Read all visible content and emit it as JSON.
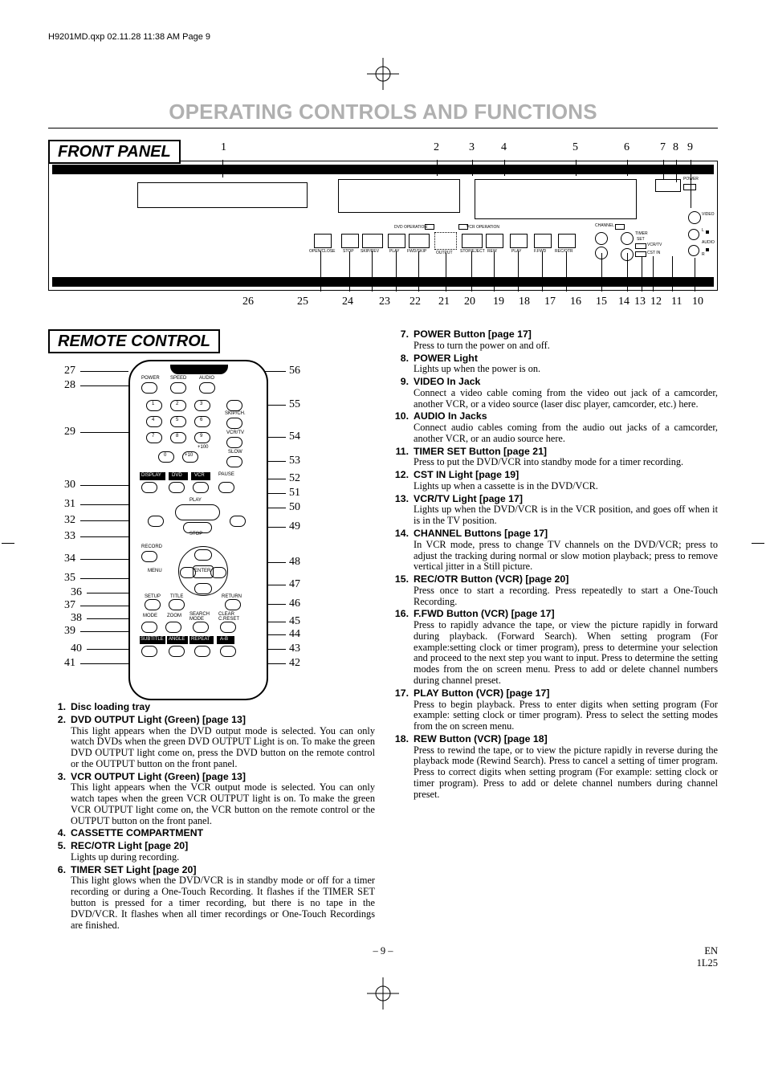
{
  "header_line": "H9201MD.qxp  02.11.28 11:38 AM  Page 9",
  "page_title": "OPERATING CONTROLS AND FUNCTIONS",
  "labels": {
    "front_panel": "FRONT PANEL",
    "remote_control": "REMOTE CONTROL"
  },
  "front_panel": {
    "callouts_top": [
      "1",
      "2",
      "3",
      "4",
      "5",
      "6",
      "7",
      "8",
      "9"
    ],
    "callouts_bottom": [
      "26",
      "25",
      "24",
      "23",
      "22",
      "21",
      "20",
      "19",
      "18",
      "17",
      "16",
      "15",
      "14",
      "13",
      "12",
      "11",
      "10"
    ],
    "panel_text": {
      "dvd_op": "DVD OPERATION",
      "vcr_op": "VCR OPERATION",
      "open_close": "OPEN/CLOSE",
      "stop": "STOP",
      "skip_rev": "SKIP/REV",
      "play": "PLAY",
      "fwd_skip": "FWD/SKIP",
      "output": "OUTPUT",
      "stop2": "STOP/EJECT",
      "rew": "REW",
      "play2": "PLAY",
      "ffwd": "F.FWD",
      "rec_otr": "REC/OTR",
      "channel": "CHANNEL",
      "timer": "TIMER",
      "set": "SET",
      "vcr_tv": "VCR/TV",
      "cst_in": "CST IN",
      "power": "POWER",
      "video": "VIDEO",
      "audio": "AUDIO",
      "l": "L",
      "r": "R"
    }
  },
  "remote": {
    "callouts_left": [
      "27",
      "28",
      "29",
      "30",
      "31",
      "32",
      "33",
      "34",
      "35",
      "36",
      "37",
      "38",
      "39",
      "40",
      "41"
    ],
    "callouts_right": [
      "56",
      "55",
      "54",
      "53",
      "52",
      "51",
      "50",
      "49",
      "48",
      "47",
      "46",
      "45",
      "44",
      "43",
      "42"
    ],
    "labels": {
      "power": "POWER",
      "speed": "SPEED",
      "audio": "AUDIO",
      "skip_ch": "SKIP/CH.",
      "vcr_tv": "VCR/TV",
      "slow": "SLOW",
      "disp": "DISPLAY",
      "dvd": "DVD",
      "vcr": "VCR",
      "pause": "PAUSE",
      "play": "PLAY",
      "stop": "STOP",
      "record": "RECORD",
      "menu": "MENU",
      "enter": "ENTER",
      "setup": "SETUP",
      "title": "TITLE",
      "return": "RETURN",
      "mode": "MODE",
      "zoom": "ZOOM",
      "search_mode": "SEARCH\nMODE",
      "clear_creset": "CLEAR\nC.RESET",
      "subtitle": "SUBTITLE",
      "angle": "ANGLE",
      "repeat": "REPEAT",
      "ab": "A-B",
      "k1": "1",
      "k2": "2",
      "k3": "3",
      "k4": "4",
      "k5": "5",
      "k6": "6",
      "k7": "7",
      "k8": "8",
      "k9": "9",
      "k0": "0",
      "p10": "+10",
      "p100": "+100"
    }
  },
  "descriptions": [
    {
      "n": "1.",
      "t": "Disc loading tray",
      "b": ""
    },
    {
      "n": "2.",
      "t": "DVD  OUTPUT Light (Green) [page 13]",
      "b": "This light appears when the DVD output mode is selected.  You can only watch DVDs when the green DVD OUTPUT Light is on. To make the green DVD OUTPUT light come on, press the DVD button on the remote control or the OUTPUT button on the front panel."
    },
    {
      "n": "3.",
      "t": "VCR OUTPUT Light (Green) [page 13]",
      "b": "This light appears when the VCR output mode is selected.  You can only watch tapes when the green VCR OUTPUT light is on. To make the green VCR OUTPUT light come on, the VCR button on the remote control or the OUTPUT button on the front panel."
    },
    {
      "n": "4.",
      "t": "CASSETTE COMPARTMENT",
      "b": ""
    },
    {
      "n": "5.",
      "t": "REC/OTR Light [page 20]",
      "b": "Lights up during recording."
    },
    {
      "n": "6.",
      "t": "TIMER SET Light [page 20]",
      "b": "This light glows when the DVD/VCR is in standby mode or off for a timer recording or during a One-Touch Recording. It flashes if the TIMER SET button is pressed for a timer recording, but there is no tape in the DVD/VCR. It flashes when all timer recordings or One-Touch Recordings are finished."
    },
    {
      "n": "7.",
      "t": "POWER Button [page 17]",
      "b": "Press to turn the power on and off."
    },
    {
      "n": "8.",
      "t": "POWER Light",
      "b": "Lights up when the power is on."
    },
    {
      "n": "9.",
      "t": "VIDEO In Jack",
      "b": "Connect a video cable coming from the video out jack of a camcorder, another VCR, or a video source (laser disc player, camcorder, etc.) here."
    },
    {
      "n": "10.",
      "t": "AUDIO In Jacks",
      "b": "Connect audio cables coming from the audio out jacks of a camcorder, another VCR, or an audio source here."
    },
    {
      "n": "11.",
      "t": "TIMER SET Button [page 21]",
      "b": "Press to put the DVD/VCR into standby mode for a timer recording."
    },
    {
      "n": "12.",
      "t": "CST IN Light [page 19]",
      "b": "Lights up when a cassette is in the DVD/VCR."
    },
    {
      "n": "13.",
      "t": "VCR/TV Light [page 17]",
      "b": "Lights up when the DVD/VCR is in the VCR position, and goes off when it is in the TV position."
    },
    {
      "n": "14.",
      "t": "CHANNEL Buttons [page 17]",
      "b": "In VCR mode, press to change TV channels on the DVD/VCR; press to adjust the tracking during normal or slow motion playback; press to remove vertical jitter in a Still picture."
    },
    {
      "n": "15.",
      "t": "REC/OTR Button (VCR) [page 20]",
      "b": "Press once to start a recording. Press repeatedly to start a One-Touch Recording."
    },
    {
      "n": "16.",
      "t": "F.FWD Button (VCR) [page 17]",
      "b": "Press to rapidly advance the tape, or view the picture rapidly in forward during playback. (Forward Search). When setting program (For example:setting clock or timer program), press to determine your selection and proceed to the next step you want to input.  Press to determine the setting modes from the on screen menu.  Press to add or delete channel numbers during channel preset."
    },
    {
      "n": "17.",
      "t": "PLAY Button (VCR) [page 17]",
      "b": "Press to begin playback.  Press to enter digits when setting program (For example: setting clock or timer program).  Press to select the setting modes from the on screen menu."
    },
    {
      "n": "18.",
      "t": "REW Button (VCR) [page 18]",
      "b": "Press to rewind the tape, or to view the picture rapidly in reverse during the playback mode (Rewind Search).  Press to cancel a setting of  timer program.  Press to correct digits when setting program (For example: setting clock or timer program).  Press to add or delete channel numbers during channel preset."
    }
  ],
  "footer": {
    "page": "– 9 –",
    "code1": "EN",
    "code2": "1L25"
  }
}
